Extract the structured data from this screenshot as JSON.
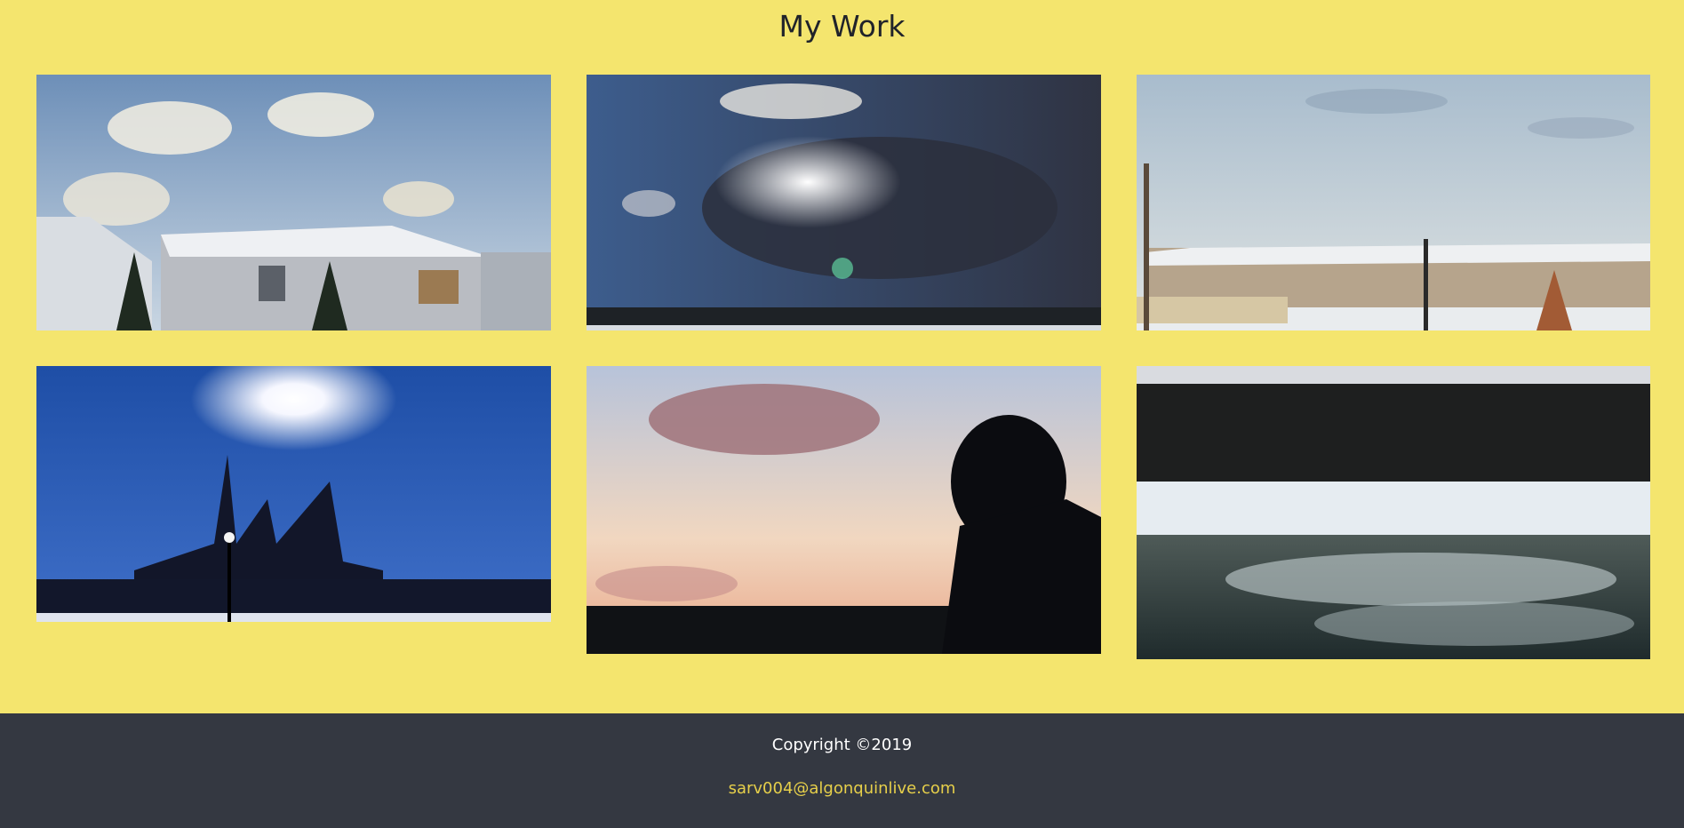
{
  "header": {
    "title": "My Work"
  },
  "gallery": [
    {
      "subject": "houses-under-clouds"
    },
    {
      "subject": "sun-through-storm-clouds"
    },
    {
      "subject": "townhouses-in-snow"
    },
    {
      "subject": "parliament-silhouette-sun"
    },
    {
      "subject": "person-silhouette-sunset"
    },
    {
      "subject": "icy-river-rapids"
    }
  ],
  "footer": {
    "copyright": "Copyright ©2019",
    "email": "sarv004@algonquinlive.com"
  },
  "colors": {
    "background": "#f4e56e",
    "footer_background": "#343841",
    "email_link": "#e6cf4a"
  }
}
